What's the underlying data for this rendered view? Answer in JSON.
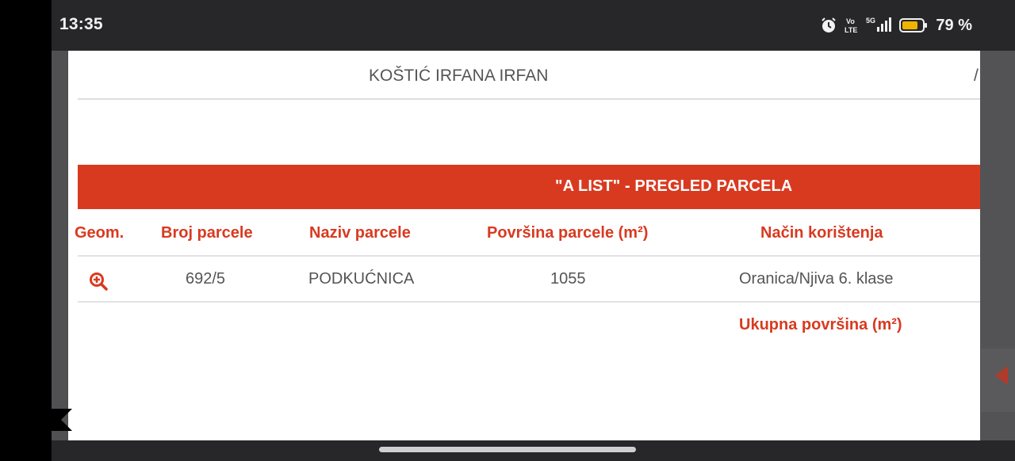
{
  "status_bar": {
    "time": "13:35",
    "icons": [
      "alarm-icon",
      "volte-icon",
      "5g-signal-icon",
      "battery-icon"
    ],
    "volte_text": "Vo LTE",
    "network_text": "5G",
    "battery_percent": "79 %",
    "battery_level": 0.79,
    "battery_color": "#f0b400"
  },
  "owner": {
    "name": "KOŠTIĆ IRFANA IRFAN",
    "trailing": "/"
  },
  "section": {
    "title": "\"A LIST\" - PREGLED PARCELA",
    "color": "#d83a20"
  },
  "table": {
    "headers": {
      "geom": "Geom.",
      "broj": "Broj parcele",
      "naziv": "Naziv parcele",
      "povrsina": "Površina parcele (m²)",
      "nacin": "Način korištenja"
    },
    "rows": [
      {
        "geom_icon": "zoom-in-icon",
        "broj": "692/5",
        "naziv": "PODKUĆNICA",
        "povrsina": "1055",
        "nacin": "Oranica/Njiva 6. klase"
      }
    ],
    "total_label": "Ukupna površina (m²)"
  }
}
